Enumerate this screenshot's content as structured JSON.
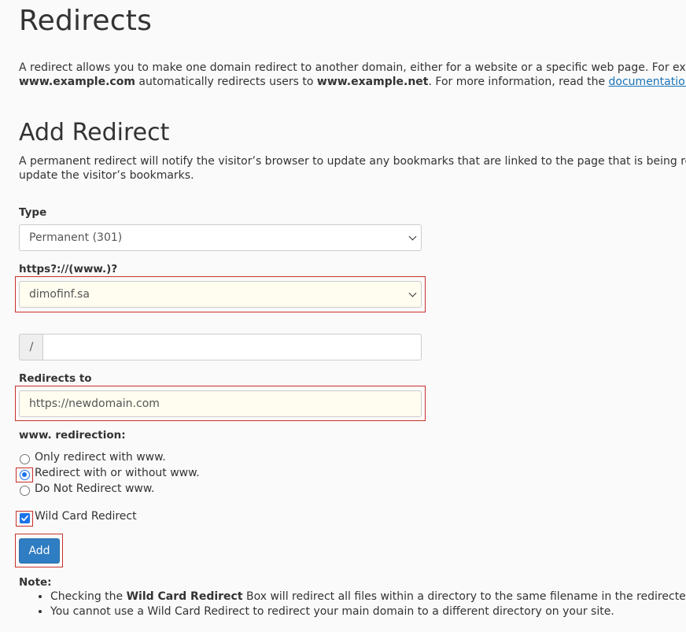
{
  "page": {
    "title": "Redirects",
    "intro": {
      "line1": "A redirect allows you to make one domain redirect to another domain, either for a website or a specific web page. For example, cre",
      "line2_bold1": "www.example.com",
      "line2_mid": " automatically redirects users to ",
      "line2_bold2": "www.example.net",
      "line2_after": ". For more information, read the ",
      "link": "documentation",
      "line2_end": "."
    }
  },
  "add_redirect": {
    "heading": "Add Redirect",
    "description_line1": "A permanent redirect will notify the visitor’s browser to update any bookmarks that are linked to the page that is being redirected. T",
    "description_line2": "update the visitor’s bookmarks.",
    "type": {
      "label": "Type",
      "selected": "Permanent (301)"
    },
    "domain": {
      "label": "https?://(www.)?",
      "selected": "dimofinf.sa"
    },
    "path": {
      "prefix": "/",
      "value": ""
    },
    "redirects_to": {
      "label": "Redirects to",
      "value": "https://newdomain.com"
    },
    "www_redirection": {
      "label": "www. redirection:",
      "options": [
        {
          "label": "Only redirect with www.",
          "checked": false
        },
        {
          "label": "Redirect with or without www.",
          "checked": true
        },
        {
          "label": "Do Not Redirect www.",
          "checked": false
        }
      ]
    },
    "wildcard": {
      "label": "Wild Card Redirect",
      "checked": true
    },
    "add_button": "Add",
    "note": {
      "heading": "Note:",
      "item1_pre": "Checking the ",
      "item1_bold": "Wild Card Redirect",
      "item1_post": " Box will redirect all files within a directory to the same filename in the redirected directory.",
      "item2": "You cannot use a Wild Card Redirect to redirect your main domain to a different directory on your site."
    }
  },
  "colors": {
    "highlight": "#c9302c",
    "button": "#2f7dc2",
    "link": "#1a73b8",
    "accent": "#1a73e8"
  }
}
